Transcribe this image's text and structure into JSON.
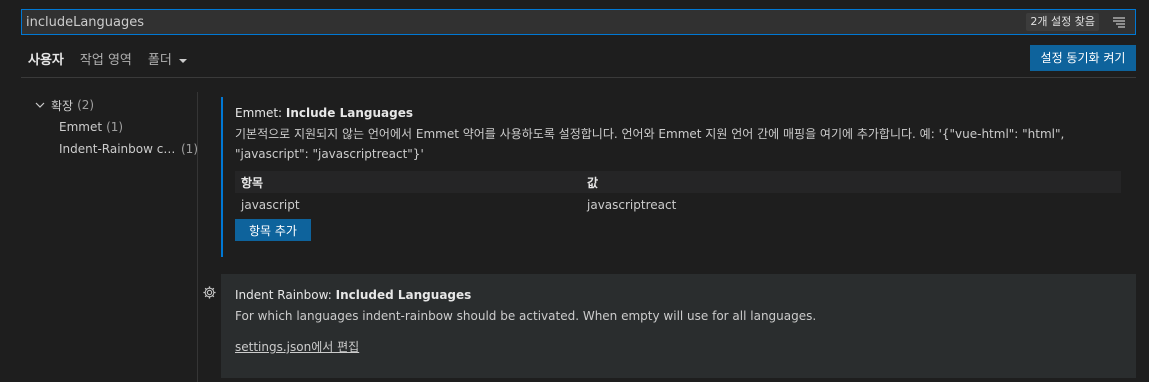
{
  "search": {
    "value": "includeLanguages",
    "result_count": "2개 설정 찾음",
    "filter_icon": "filter-list-icon"
  },
  "tabs": [
    {
      "label": "사용자",
      "active": true
    },
    {
      "label": "작업 영역",
      "active": false
    },
    {
      "label": "폴더",
      "active": false
    }
  ],
  "sync_button": "설정 동기화 켜기",
  "toc": {
    "root": {
      "label": "확장",
      "count": "(2)"
    },
    "children": [
      {
        "label": "Emmet",
        "count": "(1)"
      },
      {
        "label": "Indent-Rainbow co...",
        "count": "(1)"
      }
    ]
  },
  "settings": {
    "emmet": {
      "category": "Emmet: ",
      "name": "Include Languages",
      "description": "기본적으로 지원되지 않는 언어에서 Emmet 약어를 사용하도록 설정합니다. 언어와 Emmet 지원 언어 간에 매핑을 여기에 추가합니다. 예: '{\"vue-html\": \"html\", \"javascript\": \"javascriptreact\"}'",
      "table": {
        "headers": [
          "항목",
          "값"
        ],
        "rows": [
          [
            "javascript",
            "javascriptreact"
          ]
        ]
      },
      "add_button": "항목 추가"
    },
    "indent_rainbow": {
      "category": "Indent Rainbow: ",
      "name": "Included Languages",
      "description": "For which languages indent-rainbow should be activated. When empty will use for all languages.",
      "edit_link": "settings.json에서 편집"
    }
  },
  "colors": {
    "accent": "#0078d4",
    "button": "#0e639c",
    "background": "#1e1e1e"
  }
}
